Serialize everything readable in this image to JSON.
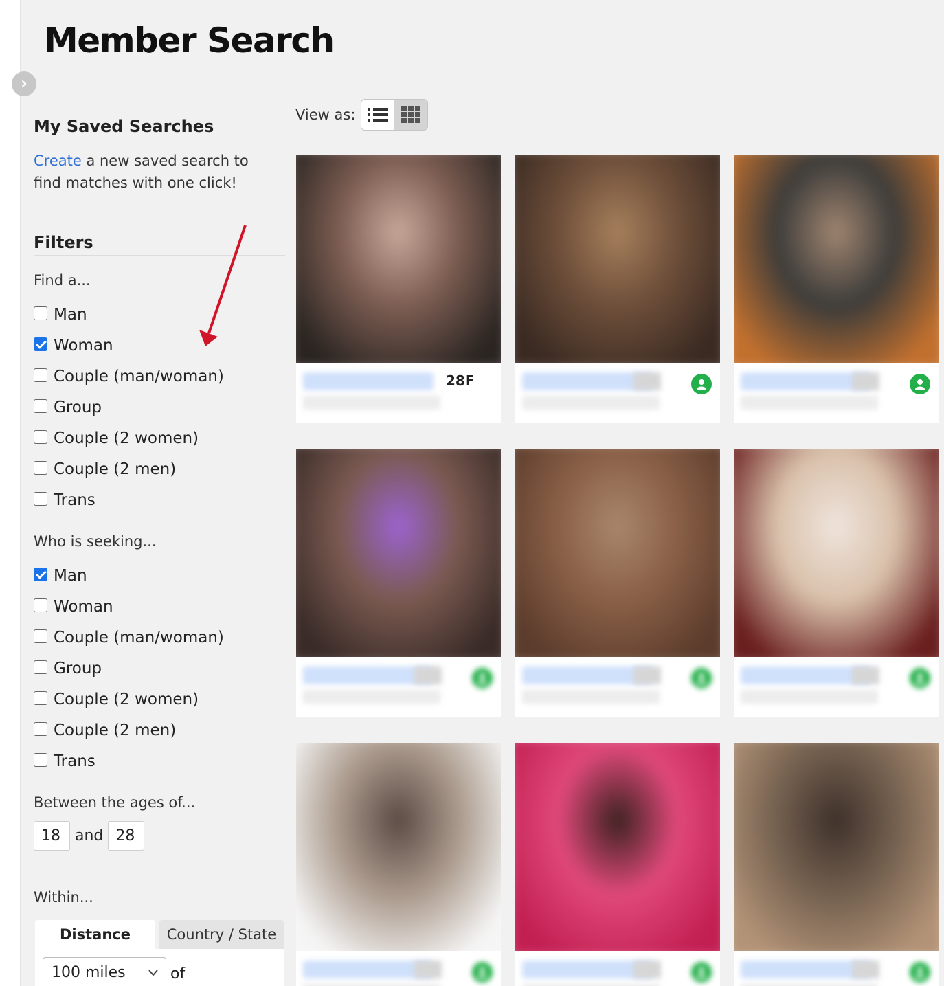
{
  "page": {
    "title": "Member Search"
  },
  "sidebar": {
    "saved_searches": {
      "title": "My Saved Searches",
      "create_link": "Create",
      "create_text": " a new saved search to find matches with one click!"
    },
    "filters": {
      "title": "Filters",
      "find_label": "Find a...",
      "find_options": [
        {
          "label": "Man",
          "checked": false
        },
        {
          "label": "Woman",
          "checked": true
        },
        {
          "label": "Couple (man/woman)",
          "checked": false
        },
        {
          "label": "Group",
          "checked": false
        },
        {
          "label": "Couple (2 women)",
          "checked": false
        },
        {
          "label": "Couple (2 men)",
          "checked": false
        },
        {
          "label": "Trans",
          "checked": false
        }
      ],
      "seeking_label": "Who is seeking...",
      "seeking_options": [
        {
          "label": "Man",
          "checked": true
        },
        {
          "label": "Woman",
          "checked": false
        },
        {
          "label": "Couple (man/woman)",
          "checked": false
        },
        {
          "label": "Group",
          "checked": false
        },
        {
          "label": "Couple (2 women)",
          "checked": false
        },
        {
          "label": "Couple (2 men)",
          "checked": false
        },
        {
          "label": "Trans",
          "checked": false
        }
      ],
      "ages_label": "Between the ages of...",
      "age_min": "18",
      "age_and": "and",
      "age_max": "28",
      "within_label": "Within...",
      "tabs": {
        "distance": "Distance",
        "country_state": "Country / State"
      },
      "distance_value": "100 miles",
      "of_label": "of"
    }
  },
  "view": {
    "label": "View as:",
    "selected": "grid"
  },
  "results": {
    "cards": [
      {
        "age_sex": "28F",
        "online": false,
        "photo_colors": [
          "#2b2522",
          "#7c5d52",
          "#c9a79b"
        ]
      },
      {
        "age_sex": "",
        "online": true,
        "photo_colors": [
          "#3a2a22",
          "#6e4f3a",
          "#a7805c"
        ]
      },
      {
        "age_sex": "",
        "online": true,
        "photo_colors": [
          "#c2702e",
          "#3d3c3a",
          "#a08570"
        ]
      },
      {
        "age_sex": "",
        "online": true,
        "photo_colors": [
          "#3a2b28",
          "#7a5a50",
          "#9b63d1"
        ]
      },
      {
        "age_sex": "",
        "online": true,
        "photo_colors": [
          "#5c3c2c",
          "#8a6047",
          "#a9876c"
        ]
      },
      {
        "age_sex": "",
        "online": true,
        "photo_colors": [
          "#6a1f1f",
          "#d9c1ab",
          "#efe4dc"
        ]
      },
      {
        "age_sex": "",
        "online": true,
        "photo_colors": [
          "#f5f5f5",
          "#a9988a",
          "#5a4a44"
        ]
      },
      {
        "age_sex": "",
        "online": true,
        "photo_colors": [
          "#c21f52",
          "#e0497a",
          "#3c2220"
        ]
      },
      {
        "age_sex": "",
        "online": true,
        "photo_colors": [
          "#b39377",
          "#73604f",
          "#3e302a"
        ]
      }
    ]
  },
  "colors": {
    "link": "#2f6fd6",
    "checkbox_checked": "#1a73e8",
    "online": "#23b04a",
    "annotation_arrow": "#d0142a"
  }
}
